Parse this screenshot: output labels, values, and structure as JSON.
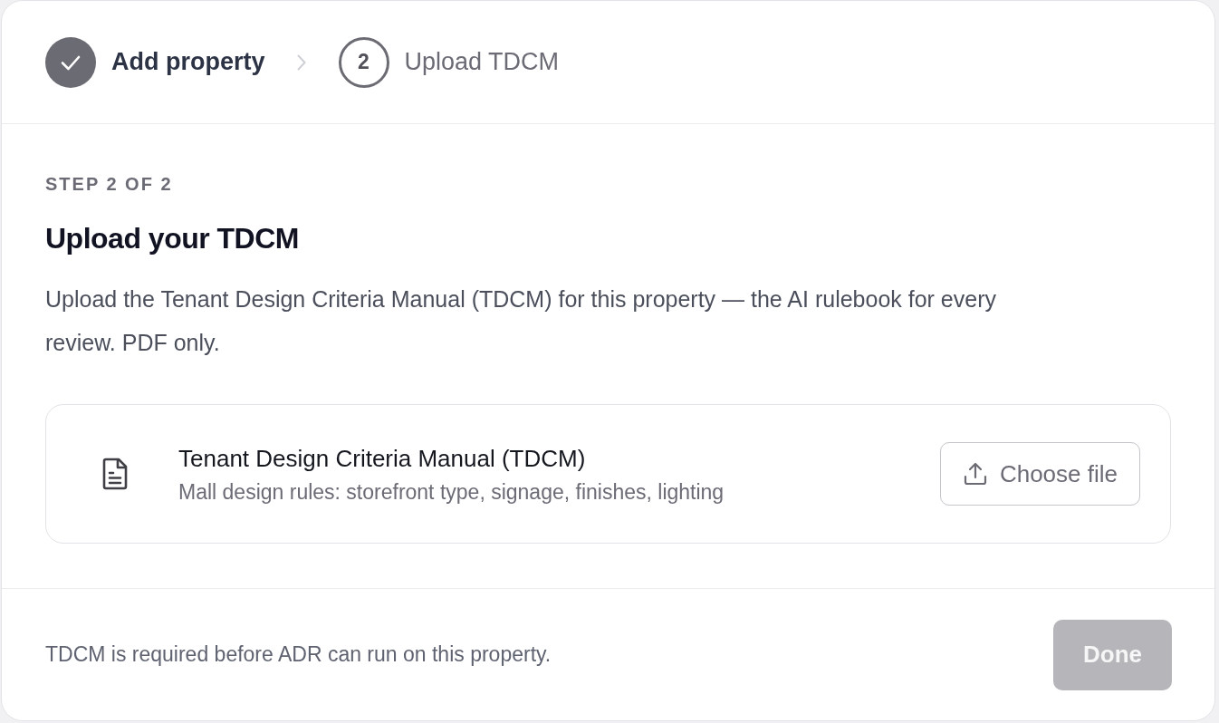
{
  "stepper": {
    "steps": [
      {
        "label": "Add property",
        "completed": true
      },
      {
        "number": "2",
        "label": "Upload TDCM",
        "completed": false
      }
    ]
  },
  "content": {
    "eyebrow": "STEP 2 OF 2",
    "title": "Upload your TDCM",
    "description": "Upload the Tenant Design Criteria Manual (TDCM) for this property — the AI rulebook for every review. PDF only.",
    "upload": {
      "title": "Tenant Design Criteria Manual (TDCM)",
      "subtitle": "Mall design rules: storefront type, signage, finishes, lighting",
      "button": "Choose file"
    }
  },
  "footer": {
    "note": "TDCM is required before ADR can run on this property.",
    "button": {
      "label": "Done",
      "disabled": true
    }
  }
}
